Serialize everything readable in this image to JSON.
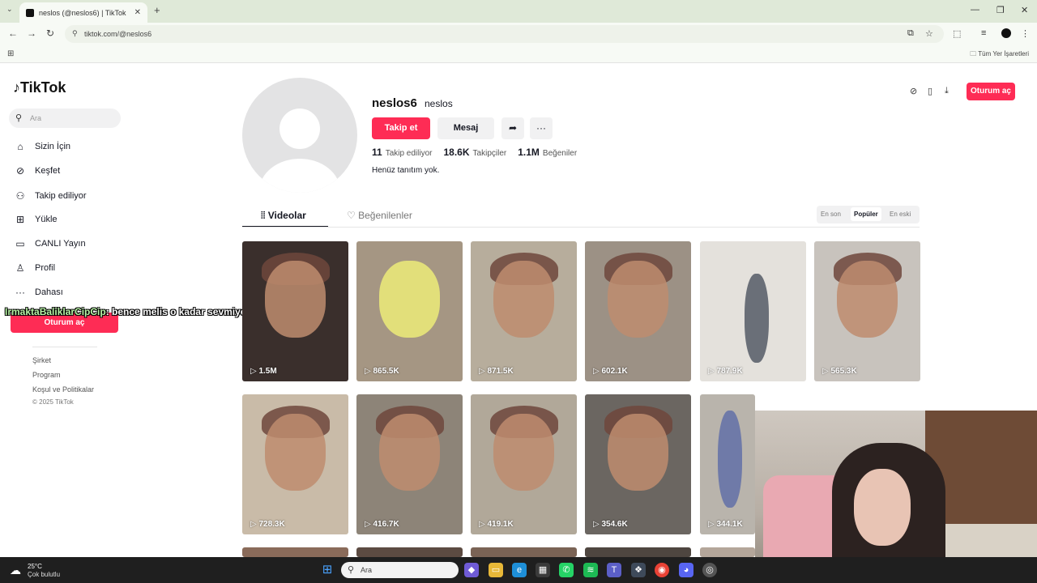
{
  "browser": {
    "tab_title": "neslos (@neslos6) | TikTok",
    "url": "tiktok.com/@neslos6",
    "bookmarks_all": "Tüm Yer İşaretleri"
  },
  "sidebar": {
    "logo": "TikTok",
    "search_placeholder": "Ara",
    "items": [
      {
        "label": "Sizin İçin",
        "icon": "home-icon"
      },
      {
        "label": "Keşfet",
        "icon": "compass-icon"
      },
      {
        "label": "Takip ediliyor",
        "icon": "following-icon"
      },
      {
        "label": "Yükle",
        "icon": "upload-icon"
      },
      {
        "label": "CANLI Yayın",
        "icon": "live-icon"
      },
      {
        "label": "Profil",
        "icon": "profile-icon"
      },
      {
        "label": "Dahası",
        "icon": "more-icon"
      }
    ],
    "login": "Oturum aç",
    "footer": [
      "Şirket",
      "Program",
      "Koşul ve Politikalar"
    ],
    "copyright": "© 2025 TikTok"
  },
  "chat": {
    "user": "IrmaktaBaliklarCipCip",
    "message": ": bence melis o kadar sevmiyodu ya"
  },
  "profile": {
    "username": "neslos6",
    "nickname": "neslos",
    "follow": "Takip et",
    "message": "Mesaj",
    "following_count": "11",
    "following_label": "Takip ediliyor",
    "followers_count": "18.6K",
    "followers_label": "Takipçiler",
    "likes_count": "1.1M",
    "likes_label": "Beğeniler",
    "bio": "Henüz tanıtım yok."
  },
  "header": {
    "login": "Oturum aç"
  },
  "tabs": {
    "videos": "Videolar",
    "liked": "Beğenilenler"
  },
  "sort": {
    "latest": "En son",
    "popular": "Popüler",
    "oldest": "En eski",
    "selected": "Popüler"
  },
  "videos": [
    {
      "views": "1.5M"
    },
    {
      "views": "865.5K"
    },
    {
      "views": "871.5K"
    },
    {
      "views": "602.1K"
    },
    {
      "views": "787.9K"
    },
    {
      "views": "565.3K"
    },
    {
      "views": "728.3K"
    },
    {
      "views": "416.7K"
    },
    {
      "views": "419.1K"
    },
    {
      "views": "354.6K"
    },
    {
      "views": "344.1K"
    }
  ],
  "taskbar": {
    "temperature": "25°C",
    "weather": "Çok bulutlu",
    "search": "Ara"
  },
  "colors": {
    "accent": "#fe2c55",
    "browser_frame": "#dfe9d8"
  }
}
